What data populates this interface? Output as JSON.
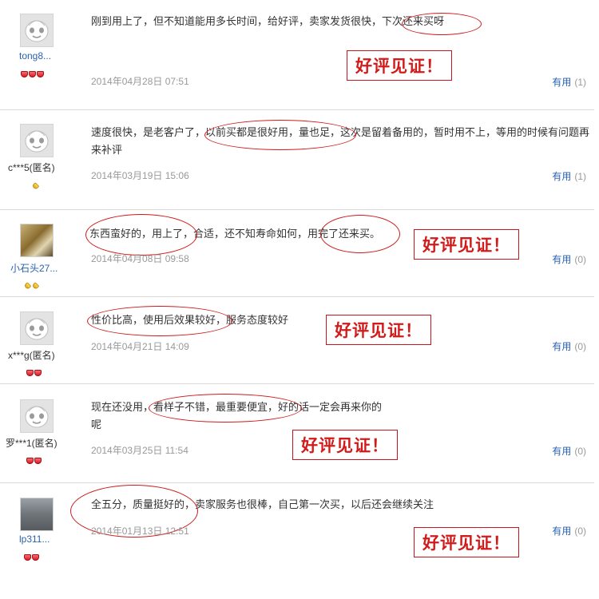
{
  "reviews": [
    {
      "user": "tong8...",
      "content": "刚到用上了，但不知道能用多长时间，给好评，卖家发货很快，下次还来买呀",
      "date": "2014年04月28日 07:51",
      "useful_label": "有用",
      "useful_count": "(1)",
      "stamp": "好评见证！",
      "badge_type": "red",
      "badge_count": 3
    },
    {
      "user": "c***5(匿名)",
      "content": "速度很快，是老客户了，以前买都是很好用，量也足，这次是留着备用的，暂时用不上，等用的时候有问题再来补评",
      "date": "2014年03月19日 15:06",
      "useful_label": "有用",
      "useful_count": "(1)",
      "badge_type": "gold",
      "badge_count": 1
    },
    {
      "user": "小石头27...",
      "content": "东西蛮好的，用上了，合适，还不知寿命如何，用完了还来买。",
      "date": "2014年04月08日 09:58",
      "useful_label": "有用",
      "useful_count": "(0)",
      "stamp": "好评见证！",
      "badge_type": "gold",
      "badge_count": 2
    },
    {
      "user": "x***g(匿名)",
      "content": "性价比高，使用后效果较好，服务态度较好",
      "date": "2014年04月21日 14:09",
      "useful_label": "有用",
      "useful_count": "(0)",
      "stamp": "好评见证！",
      "badge_type": "red",
      "badge_count": 2
    },
    {
      "user": "罗***1(匿名)",
      "content": "现在还没用，看样子不错，最重要便宜，好的话一定会再来你的呢",
      "date": "2014年03月25日 11:54",
      "useful_label": "有用",
      "useful_count": "(0)",
      "stamp": "好评见证！",
      "badge_type": "red",
      "badge_count": 2
    },
    {
      "user": "lp311...",
      "content": "全五分，质量挺好的，卖家服务也很棒，自己第一次买，以后还会继续关注",
      "date": "2014年01月13日 12:51",
      "useful_label": "有用",
      "useful_count": "(0)",
      "stamp": "好评见证！",
      "badge_type": "red",
      "badge_count": 2
    }
  ],
  "colors": {
    "link": "#2a62b0",
    "stamp_red": "#d11a1a",
    "annotation_red": "#cf1a1a",
    "date_gray": "#999999"
  },
  "icons": {
    "default_avatar": "ghost-face-icon",
    "badge_red": "red-heart-diamond-icon",
    "badge_gold": "gold-diamond-icon"
  }
}
